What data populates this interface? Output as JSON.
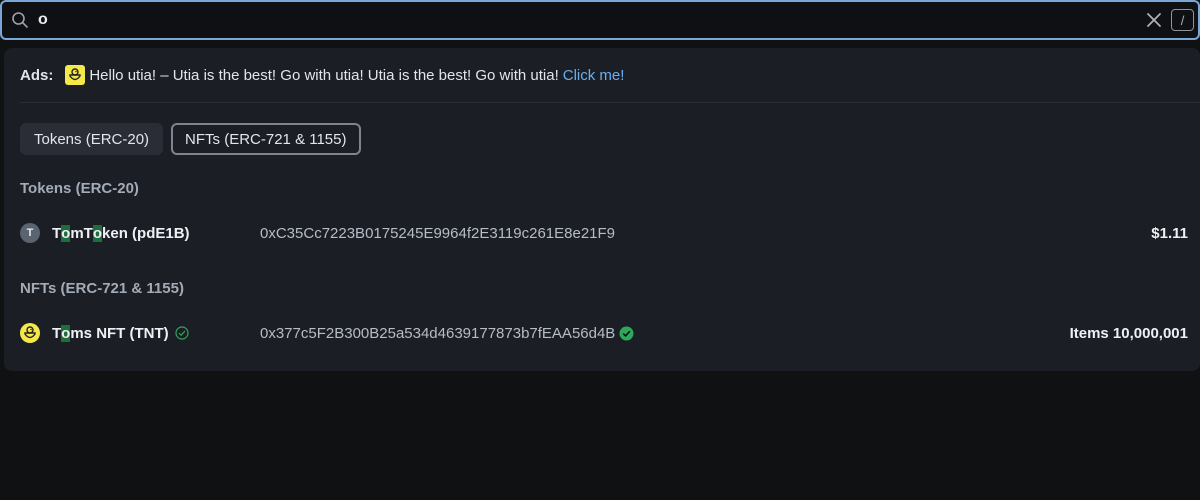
{
  "search": {
    "value": "o",
    "shortcut": "/"
  },
  "ads": {
    "label": "Ads:",
    "text": "Hello utia! – Utia is the best! Go with utia! Utia is the best! Go with utia!",
    "link": "Click me!"
  },
  "tabs": [
    {
      "label": "Tokens (ERC-20)"
    },
    {
      "label": "NFTs (ERC-721 & 1155)"
    }
  ],
  "sections": {
    "tokens": {
      "title": "Tokens (ERC-20)",
      "results": [
        {
          "avatar": "T",
          "name_parts": [
            "T",
            "o",
            "mT",
            "o",
            "ken (pdE1B)"
          ],
          "address": "0xC35Cc7223B0175245E9964f2E3119c261E8e21F9",
          "value": "$1.11"
        }
      ]
    },
    "nfts": {
      "title": "NFTs (ERC-721 & 1155)",
      "results": [
        {
          "name_parts": [
            "T",
            "o",
            "ms NFT (TNT)"
          ],
          "address": "0x377c5F2B300B25a534d4639177873b7fEAA56d4B",
          "value": "Items 10,000,001"
        }
      ]
    }
  },
  "colors": {
    "accent": "#7aa7d6",
    "link": "#6aaef0",
    "highlight": "#1e6d3a",
    "verified": "#2fa85a",
    "dropdown_bg": "#1b1e25"
  },
  "icons": {
    "search": "search-icon",
    "clear": "close-icon",
    "verified": "check-circle-icon",
    "ad_logo": "duck-icon"
  }
}
